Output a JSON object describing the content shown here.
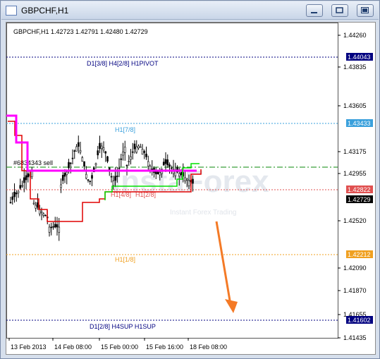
{
  "window": {
    "title": "GBPCHF,H1"
  },
  "info_line": "GBPCHF,H1  1.42723 1.42791 1.42480 1.42729",
  "watermark": "InstaForex",
  "watermark_sub": "Instant Forex Trading",
  "colors": {
    "candle": "#000000",
    "red_line": "#e00000",
    "magenta_line": "#ff00ff",
    "green_line": "#00e000",
    "arrow": "#f47a26"
  },
  "levels": [
    {
      "label": "D1[3/8] H4[2/8] H1PIVOT",
      "price": "1.44043",
      "color": "#000080",
      "badge_bg": "#000080"
    },
    {
      "label": "H1[7/8]",
      "price": "1.43433",
      "color": "#3aa0dc",
      "badge_bg": "#3aa0dc"
    },
    {
      "label": "",
      "price": "1.42822",
      "color": "#e05050",
      "badge_bg": "#e05050"
    },
    {
      "label": "H1[1/8]",
      "price": "1.42212",
      "color": "#f0a020",
      "badge_bg": "#f0a020"
    },
    {
      "label": "D1[2/8] H4SUP H1SUP",
      "price": "1.41602",
      "color": "#000080",
      "badge_bg": "#000080"
    }
  ],
  "level_inline_labels": {
    "mid_left": "H1[4/8]",
    "mid_right": "H1[2/8]"
  },
  "order_label": "#6834343 sell",
  "current_price": "1.42729",
  "chart_data": {
    "type": "candlestick",
    "yticks": [
      "1.44260",
      "1.43835",
      "1.43605",
      "1.43175",
      "1.42955",
      "1.42520",
      "1.42090",
      "1.41870",
      "1.41655",
      "1.41435"
    ],
    "xticks": [
      "13 Feb 2013",
      "14 Feb 08:00",
      "15 Feb 00:00",
      "15 Feb 16:00",
      "18 Feb 08:00"
    ],
    "ylim": [
      1.4137,
      1.4437
    ]
  }
}
